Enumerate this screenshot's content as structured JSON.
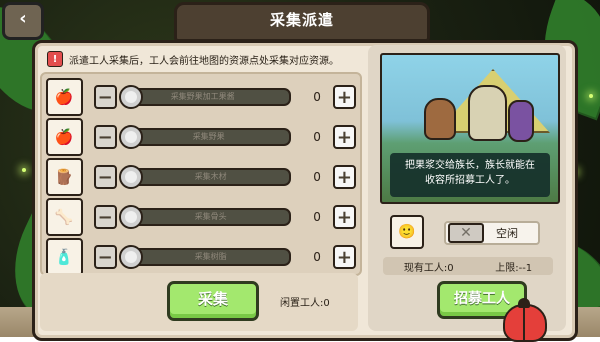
{
  "title": "采集派遣",
  "notice": {
    "icon": "warning-icon",
    "text": "派遣工人采集后，工人会前往地图的资源点处采集对应资源。"
  },
  "resources": [
    {
      "label": "采集野果加工果酱",
      "count": "0",
      "icon": "apple-icon"
    },
    {
      "label": "采集野果",
      "count": "0",
      "icon": "apple-icon"
    },
    {
      "label": "采集木材",
      "count": "0",
      "icon": "wood-icon"
    },
    {
      "label": "采集骨头",
      "count": "0",
      "icon": "bone-icon"
    },
    {
      "label": "采集树脂",
      "count": "0",
      "icon": "resin-icon"
    }
  ],
  "buttons": {
    "collect": "采集",
    "recruit": "招募工人"
  },
  "idle_workers": "闲置工人:0",
  "scene": {
    "message": "把果浆交给族长，族长就能在\n收容所招募工人了。"
  },
  "worker_slot": {
    "status": "空闲"
  },
  "stats": {
    "current": "现有工人:0",
    "limit": "上限:--1"
  }
}
